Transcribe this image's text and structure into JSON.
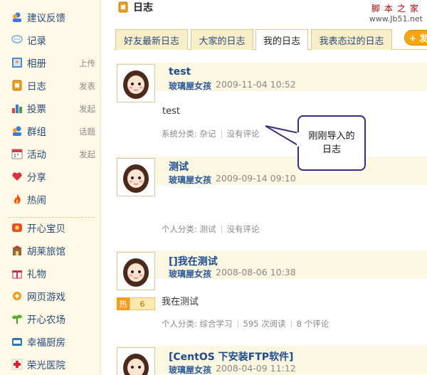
{
  "watermark": {
    "line1": "脚本之家",
    "line2": "www.Jb51.net"
  },
  "sidebar": {
    "items": [
      {
        "label": "建议反馈",
        "sub": ""
      },
      {
        "label": "记录",
        "sub": ""
      },
      {
        "label": "相册",
        "sub": "上传"
      },
      {
        "label": "日志",
        "sub": "发表"
      },
      {
        "label": "投票",
        "sub": "发起"
      },
      {
        "label": "群组",
        "sub": "话题"
      },
      {
        "label": "活动",
        "sub": "发起"
      },
      {
        "label": "分享",
        "sub": ""
      },
      {
        "label": "热闹",
        "sub": ""
      },
      {
        "label": "开心宝贝",
        "sub": ""
      },
      {
        "label": "胡莱旅馆",
        "sub": ""
      },
      {
        "label": "礼物",
        "sub": ""
      },
      {
        "label": "网页游戏",
        "sub": ""
      },
      {
        "label": "开心农场",
        "sub": ""
      },
      {
        "label": "幸福厨房",
        "sub": ""
      },
      {
        "label": "荣光医院",
        "sub": ""
      }
    ]
  },
  "header": {
    "title": "日志"
  },
  "tabs": [
    {
      "label": "好友最新日志"
    },
    {
      "label": "大家的日志"
    },
    {
      "label": "我的日志"
    },
    {
      "label": "我表态过的日志"
    }
  ],
  "tab_button": {
    "label": "+ 发"
  },
  "callout": {
    "line1": "刚刚导入的",
    "line2": "日志"
  },
  "entries": [
    {
      "title": "test",
      "author": "玻璃屋女孩",
      "date": "2009-11-04 10:52",
      "body": "test",
      "meta": [
        "系统分类: 杂记",
        "没有评论"
      ]
    },
    {
      "title": "测试",
      "author": "玻璃屋女孩",
      "date": "2009-09-14 09:10",
      "body": "",
      "meta": [
        "个人分类: 测试",
        "没有评论"
      ]
    },
    {
      "title": "[]我在测试",
      "author": "玻璃屋女孩",
      "date": "2008-08-06 10:38",
      "body": "我在测试",
      "hot_label": "热",
      "hot_count": "6",
      "meta": [
        "个人分类: 综合学习",
        "595 次阅读",
        "8 个评论"
      ]
    },
    {
      "title": "[CentOS 下安装FTP软件]",
      "author": "玻璃屋女孩",
      "date": "2008-04-09 11:12",
      "body": "",
      "meta": []
    }
  ]
}
